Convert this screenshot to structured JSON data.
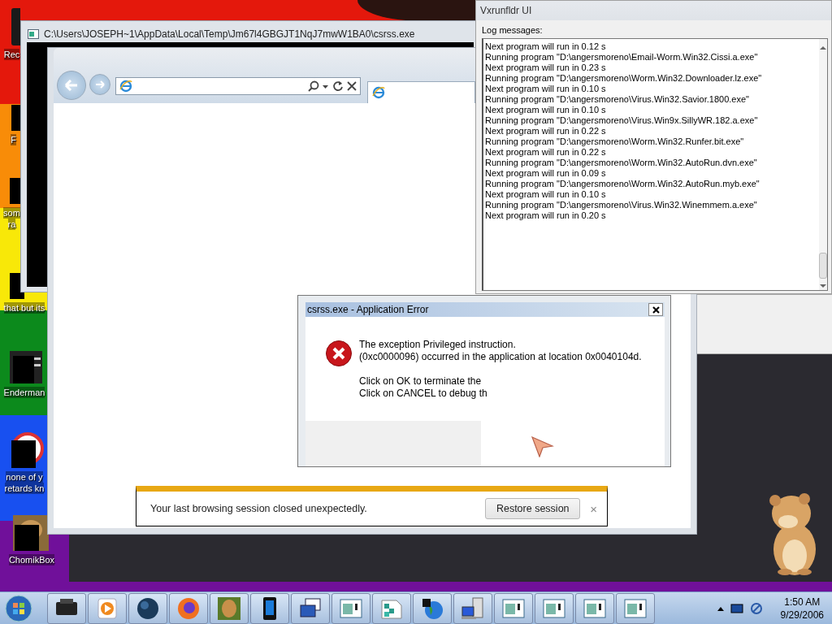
{
  "desktop": {
    "icons": [
      {
        "kind": "cylinder",
        "label_lines": [
          "Rec"
        ]
      },
      {
        "kind": "square",
        "label_lines": [
          "F"
        ]
      },
      {
        "kind": "square",
        "label_lines": [
          "som",
          "ra"
        ]
      },
      {
        "kind": "square",
        "label_lines": [
          "that but its"
        ]
      },
      {
        "kind": "console",
        "label_lines": [
          "Enderman"
        ]
      },
      {
        "kind": "circle",
        "label_lines": [
          "none of y",
          "retards kn"
        ]
      },
      {
        "kind": "hamster",
        "label_lines": [
          "ChomikBox"
        ]
      }
    ]
  },
  "console_window": {
    "title": "C:\\Users\\JOSEPH~1\\AppData\\Local\\Temp\\Jm67l4GBGJT1NqJ7mwW1BA0\\csrss.exe"
  },
  "browser": {
    "notification": {
      "message": "Your last browsing session closed unexpectedly.",
      "button": "Restore session",
      "close": "×"
    }
  },
  "log_window": {
    "title": "Vxrunfldr UI",
    "label": "Log messages:",
    "lines": [
      "Next program will run in 0.12 s",
      "Running program \"D:\\angersmoreno\\Email-Worm.Win32.Cissi.a.exe\"",
      "Next program will run in 0.23 s",
      "Running program \"D:\\angersmoreno\\Worm.Win32.Downloader.lz.exe\"",
      "Next program will run in 0.10 s",
      "Running program \"D:\\angersmoreno\\Virus.Win32.Savior.1800.exe\"",
      "Next program will run in 0.10 s",
      "Running program \"D:\\angersmoreno\\Virus.Win9x.SillyWR.182.a.exe\"",
      "Next program will run in 0.22 s",
      "Running program \"D:\\angersmoreno\\Worm.Win32.Runfer.bit.exe\"",
      "Next program will run in 0.22 s",
      "Running program \"D:\\angersmoreno\\Worm.Win32.AutoRun.dvn.exe\"",
      "Next program will run in 0.09 s",
      "Running program \"D:\\angersmoreno\\Worm.Win32.AutoRun.myb.exe\"",
      "Next program will run in 0.10 s",
      "Running program \"D:\\angersmoreno\\Virus.Win32.Winemmem.a.exe\"",
      "Next program will run in 0.20 s"
    ]
  },
  "error_dialog": {
    "title": "csrss.exe - Application Error",
    "paragraphs": [
      [
        "The exception Privileged instruction.",
        "(0xc0000096) occurred in the application at location 0x0040104d."
      ],
      [
        "Click on OK to terminate the",
        "Click on CANCEL to debug th"
      ]
    ]
  },
  "taskbar": {
    "items": [
      {
        "kind": "printer"
      },
      {
        "kind": "media"
      },
      {
        "kind": "globe"
      },
      {
        "kind": "firefox"
      },
      {
        "kind": "hamster"
      },
      {
        "kind": "phone"
      },
      {
        "kind": "stack"
      },
      {
        "kind": "window"
      },
      {
        "kind": "blocks"
      },
      {
        "kind": "world"
      },
      {
        "kind": "computer"
      },
      {
        "kind": "window"
      },
      {
        "kind": "window"
      },
      {
        "kind": "window"
      },
      {
        "kind": "window"
      }
    ],
    "clock": {
      "time": "1:50 AM",
      "date": "9/29/2006"
    }
  }
}
